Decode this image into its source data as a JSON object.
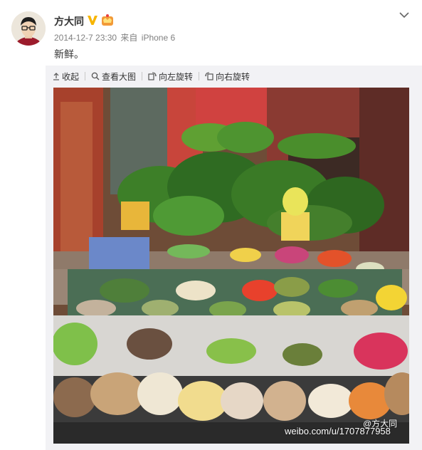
{
  "post": {
    "author": "方大同",
    "verified_icon": "verified-v-icon",
    "member_icon": "member-crown-icon",
    "timestamp": "2014-12-7 23:30",
    "source_prefix": "来自",
    "source_device": "iPhone 6",
    "text": "新鲜。"
  },
  "toolbar": {
    "collapse_label": "收起",
    "view_large_label": "查看大图",
    "rotate_left_label": "向左旋转",
    "rotate_right_label": "向右旋转"
  },
  "photo": {
    "watermark_site": "weibo.com/u/1707877958",
    "watermark_handle": "@方大同"
  },
  "colors": {
    "text_primary": "#333333",
    "text_meta": "#808080",
    "verified_badge": "#f7b500",
    "media_background": "#f2f2f5"
  }
}
